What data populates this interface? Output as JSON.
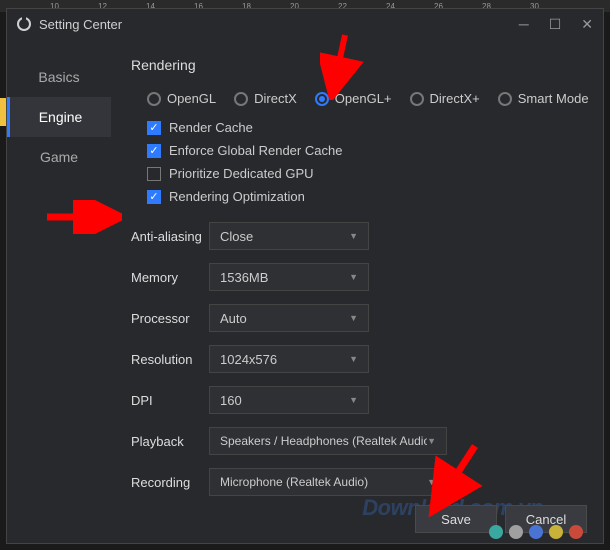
{
  "ruler": [
    "10",
    "12",
    "14",
    "16",
    "18",
    "20",
    "22",
    "24",
    "26",
    "28",
    "30"
  ],
  "window": {
    "title": "Setting Center"
  },
  "sidebar": {
    "items": [
      {
        "label": "Basics",
        "active": false
      },
      {
        "label": "Engine",
        "active": true
      },
      {
        "label": "Game",
        "active": false
      }
    ]
  },
  "rendering": {
    "title": "Rendering",
    "modes": [
      {
        "label": "OpenGL",
        "checked": false
      },
      {
        "label": "DirectX",
        "checked": false
      },
      {
        "label": "OpenGL+",
        "checked": true
      },
      {
        "label": "DirectX+",
        "checked": false
      },
      {
        "label": "Smart Mode",
        "checked": false
      }
    ],
    "checks": [
      {
        "label": "Render Cache",
        "checked": true
      },
      {
        "label": "Enforce Global Render Cache",
        "checked": true
      },
      {
        "label": "Prioritize Dedicated GPU",
        "checked": false
      },
      {
        "label": "Rendering Optimization",
        "checked": true
      }
    ]
  },
  "form": {
    "antialiasing": {
      "label": "Anti-aliasing",
      "value": "Close"
    },
    "memory": {
      "label": "Memory",
      "value": "1536MB"
    },
    "processor": {
      "label": "Processor",
      "value": "Auto"
    },
    "resolution": {
      "label": "Resolution",
      "value": "1024x576"
    },
    "dpi": {
      "label": "DPI",
      "value": "160"
    },
    "playback": {
      "label": "Playback",
      "value": "Speakers / Headphones (Realtek Audio)"
    },
    "recording": {
      "label": "Recording",
      "value": "Microphone (Realtek Audio)"
    }
  },
  "buttons": {
    "save": "Save",
    "cancel": "Cancel"
  },
  "watermark": "Download.com.vn",
  "dot_colors": [
    "#3aa7a0",
    "#a0a0a0",
    "#4a74d4",
    "#c9b23a",
    "#c94a3a"
  ]
}
